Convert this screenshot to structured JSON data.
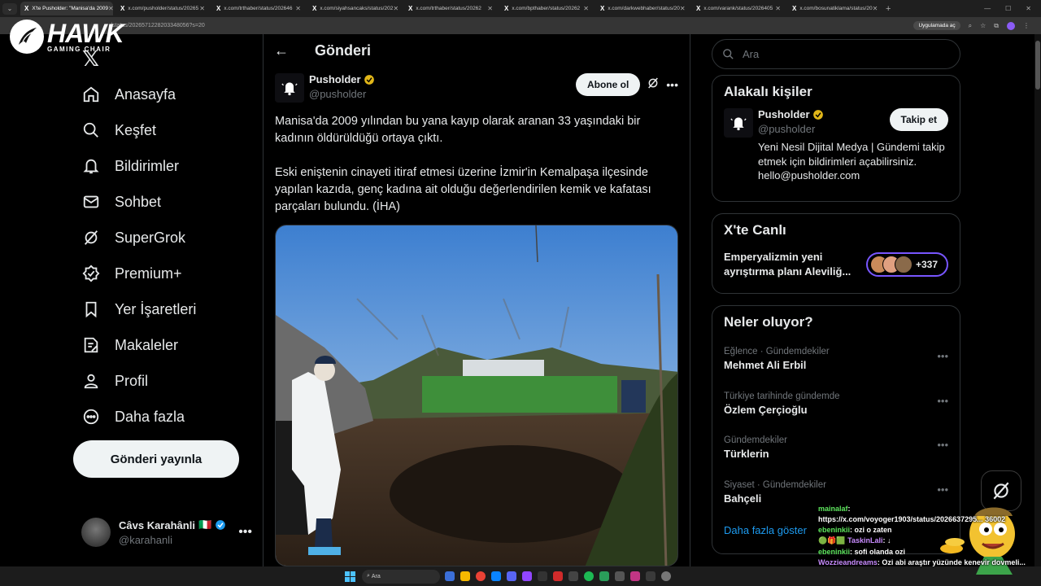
{
  "browser": {
    "tab_menu": "⌄",
    "tabs": [
      {
        "label": "X'te Pusholder: \"Manisa'da 2009",
        "active": true
      },
      {
        "label": "x.com/pusholder/status/20265"
      },
      {
        "label": "x.com/trthaber/status/202646"
      },
      {
        "label": "x.com/siyahsancaks/status/202"
      },
      {
        "label": "x.com/trthaber/status/20262"
      },
      {
        "label": "x.com/bpthaber/status/20262"
      },
      {
        "label": "x.com/darkwebhaber/status/20"
      },
      {
        "label": "x.com/varank/status/2026405"
      },
      {
        "label": "x.com/bosunatiklama/status/20"
      }
    ],
    "new_tab": "+",
    "url": "/status/2026571228203348056?s=20",
    "app_pill": "Uygulamada aç",
    "window_controls": [
      "—",
      "☐",
      "✕"
    ]
  },
  "watermark": {
    "name": "HAWK",
    "sub": "GAMING CHAIR"
  },
  "nav": {
    "brand": "𝕏",
    "items": [
      {
        "label": "Anasayfa",
        "icon": "home-icon"
      },
      {
        "label": "Keşfet",
        "icon": "search-icon"
      },
      {
        "label": "Bildirimler",
        "icon": "bell-icon"
      },
      {
        "label": "Sohbet",
        "icon": "mail-icon"
      },
      {
        "label": "SuperGrok",
        "icon": "grok-icon"
      },
      {
        "label": "Premium+",
        "icon": "verified-icon"
      },
      {
        "label": "Yer İşaretleri",
        "icon": "bookmark-icon"
      },
      {
        "label": "Makaleler",
        "icon": "article-icon"
      },
      {
        "label": "Profil",
        "icon": "profile-icon"
      },
      {
        "label": "Daha fazla",
        "icon": "more-circle-icon"
      }
    ],
    "post_button": "Gönderi yayınla",
    "account": {
      "name": "Câvs Karahânli",
      "flag": "🇮🇹",
      "handle": "@karahanli",
      "more": "•••"
    }
  },
  "main": {
    "back": "←",
    "title": "Gönderi",
    "post": {
      "author": "Pusholder",
      "handle": "@pusholder",
      "subscribe": "Abone ol",
      "more": "•••",
      "paragraph1": "Manisa'da 2009 yılından bu yana kayıp olarak aranan 33 yaşındaki bir kadının öldürüldüğü ortaya çıktı.",
      "paragraph2": "Eski eniştenin cinayeti itiraf etmesi üzerine İzmir'in Kemalpaşa ilçesinde yapılan kazıda, genç kadına ait olduğu değerlendirilen kemik ve kafatası parçaları bulundu. (İHA)"
    }
  },
  "right": {
    "search_placeholder": "Ara",
    "related": {
      "title": "Alakalı kişiler",
      "name": "Pusholder",
      "handle": "@pusholder",
      "follow": "Takip et",
      "bio": "Yeni Nesil Dijital Medya | Gündemi takip etmek için bildirimleri açabilirsiniz. hello@pusholder.com"
    },
    "live": {
      "title": "X'te Canlı",
      "text": "Emperyalizmin yeni ayrıştırma planı Aleviliğ...",
      "count": "+337"
    },
    "trends": {
      "title": "Neler oluyor?",
      "items": [
        {
          "category": "Eğlence · Gündemdekiler",
          "name": "Mehmet Ali Erbil"
        },
        {
          "category": "Türkiye tarihinde gündemde",
          "name": "Özlem Çerçioğlu"
        },
        {
          "category": "Gündemdekiler",
          "name": "Türklerin"
        },
        {
          "category": "Siyaset · Gündemdekiler",
          "name": "Bahçeli"
        }
      ],
      "more": "•••",
      "show_more": "Daha fazla göster"
    }
  },
  "chat": [
    {
      "user": "mainalaf",
      "text": ": ",
      "cls": "u-green"
    },
    {
      "user": "",
      "text": "https://x.com/voyoger1903/status/2026637295... 36002",
      "cls": ""
    },
    {
      "user": "ebeninkii",
      "text": ": ozi o zaten",
      "cls": "u-green"
    },
    {
      "user": "🟢🎁🟩 TaskinLali",
      "text": ": ↓",
      "cls": "u-purple"
    },
    {
      "user": "ebeninkii",
      "text": ": sofi olanda ozi",
      "cls": "u-green"
    },
    {
      "user": "Wozzieandreams",
      "text": ": Ozi abi araştır yüzünde kenevir dovmeli...",
      "cls": "u-purple"
    }
  ],
  "taskbar": {
    "search": "Ara"
  },
  "colors": {
    "accent": "#1d9bf0",
    "verified": "#e2b719",
    "live_border": "#7856ff",
    "background": "#000000",
    "border": "#2f3336"
  }
}
